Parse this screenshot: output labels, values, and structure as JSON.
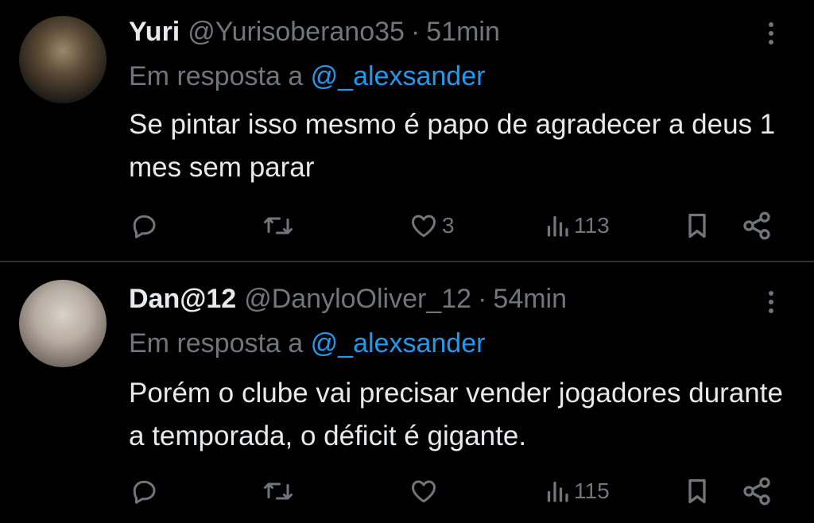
{
  "tweets": [
    {
      "display_name": "Yuri",
      "handle": "@Yurisoberano35",
      "separator": "·",
      "time": "51min",
      "reply_prefix": "Em resposta a",
      "reply_mention": "@_alexsander",
      "text": "Se pintar isso mesmo é papo de agradecer a deus 1 mes sem parar",
      "reply_count": "",
      "retweet_count": "",
      "like_count": "3",
      "view_count": "113"
    },
    {
      "display_name": "Dan@12",
      "handle": "@DanyloOliver_12",
      "separator": "·",
      "time": "54min",
      "reply_prefix": "Em resposta a",
      "reply_mention": "@_alexsander",
      "text": "Porém o clube vai precisar vender jogadores durante a temporada, o déficit é gigante.",
      "reply_count": "",
      "retweet_count": "",
      "like_count": "",
      "view_count": "115"
    }
  ],
  "icons": {
    "reply": "reply-icon",
    "retweet": "retweet-icon",
    "like": "heart-icon",
    "views": "views-icon",
    "bookmark": "bookmark-icon",
    "share": "share-icon",
    "more": "more-icon"
  },
  "colors": {
    "background": "#000000",
    "text": "#e7e9ea",
    "secondary": "#71767b",
    "link": "#1d9bf0",
    "divider": "#2f3336"
  }
}
